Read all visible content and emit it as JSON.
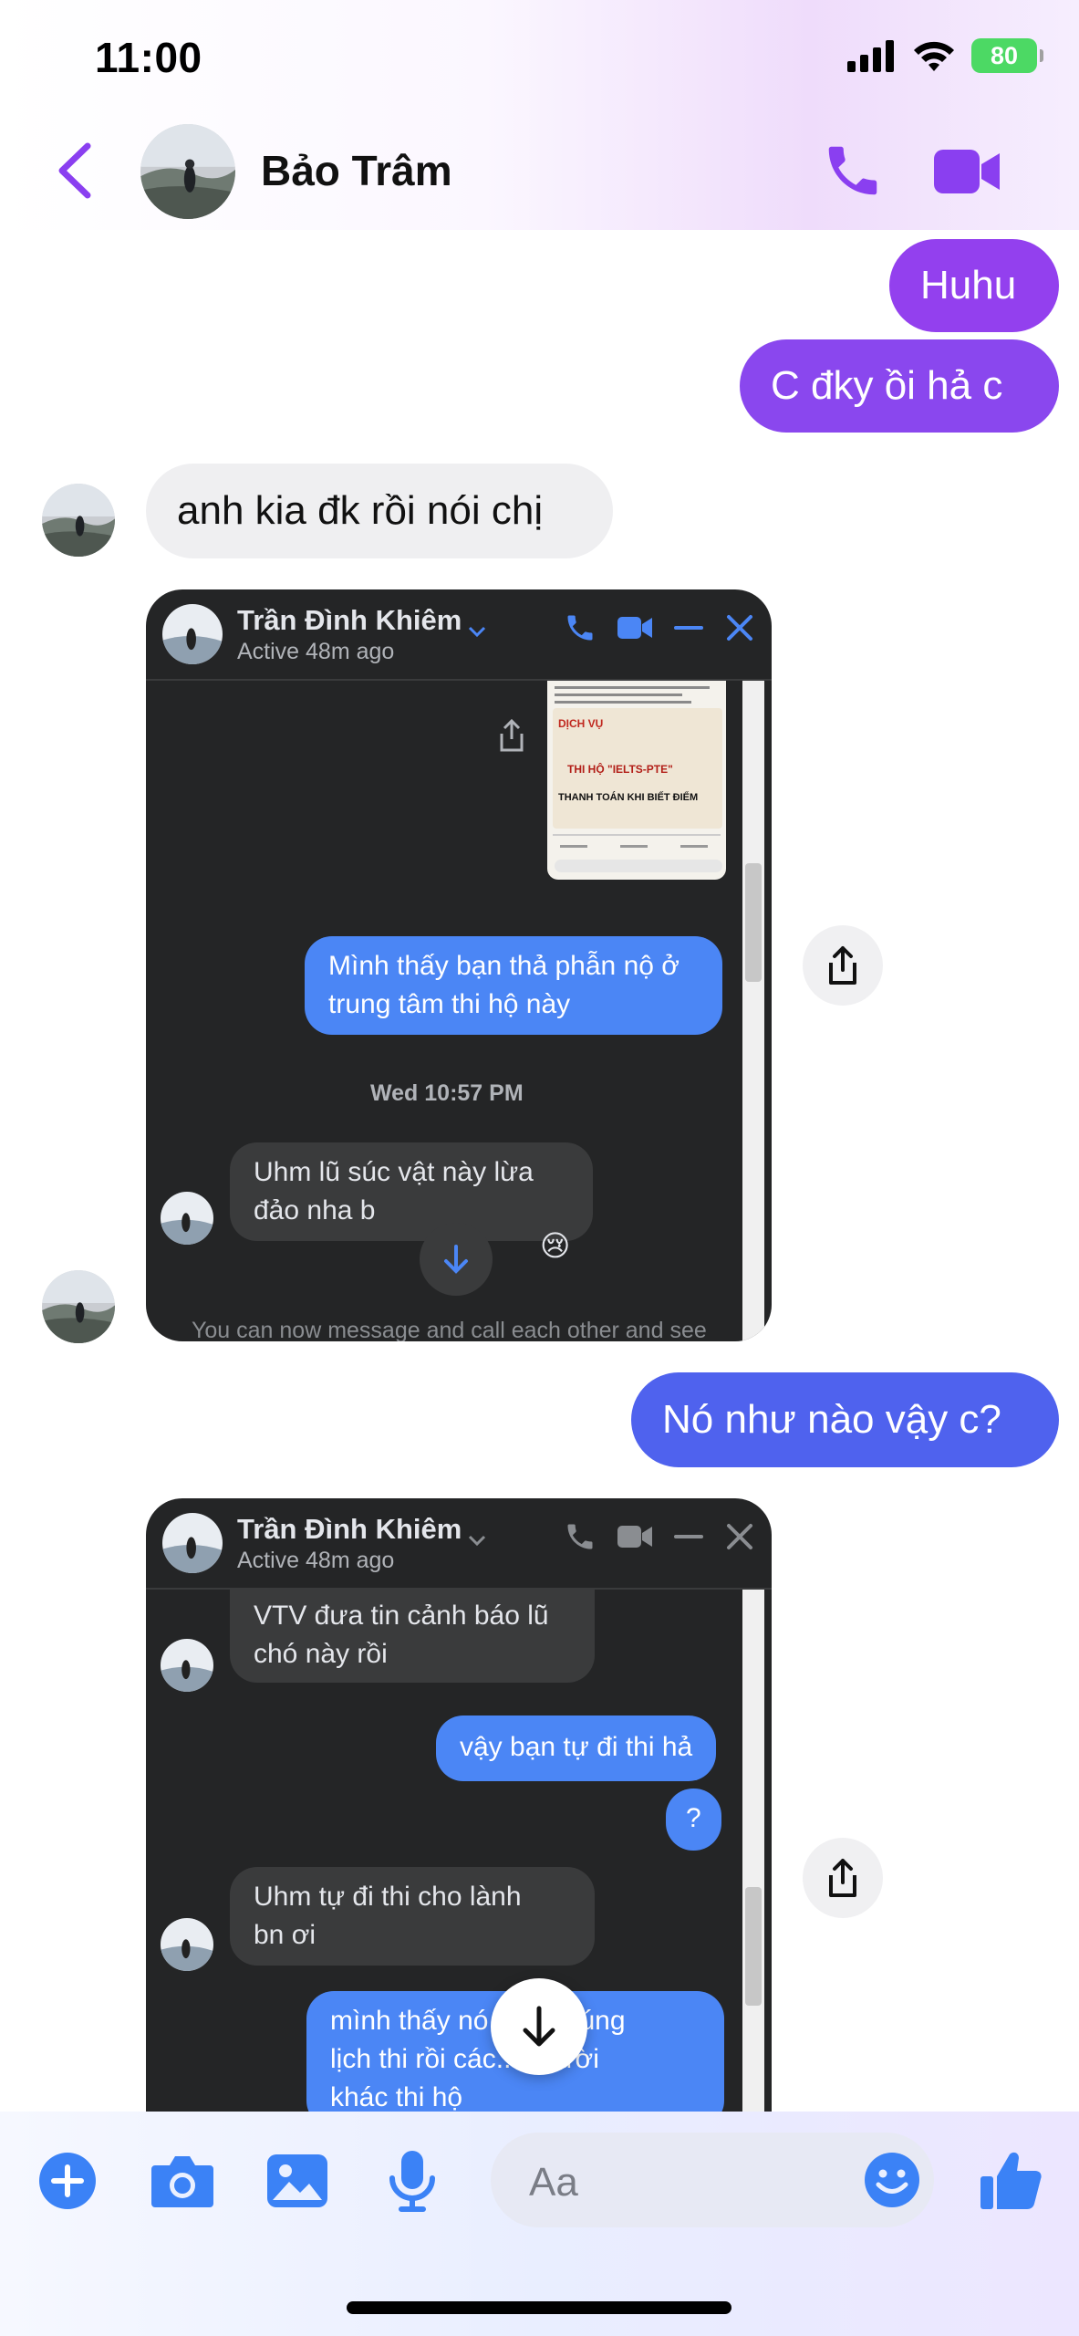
{
  "status_bar": {
    "time": "11:00",
    "battery": "80"
  },
  "header": {
    "contact_name": "Bảo Trâm"
  },
  "messages": [
    {
      "id": "m1",
      "text": "Huhu"
    },
    {
      "id": "m2",
      "text": "C đky ồi hả c"
    },
    {
      "id": "m3",
      "text": "anh kia đk rồi nói chị"
    },
    {
      "id": "m4",
      "text": "Nó như nào vậy c?"
    }
  ],
  "shared_screenshot_1": {
    "name": "Trần Đình Khiêm",
    "active": "Active 48m ago",
    "ad_lines": [
      "DỊCH VỤ",
      "THI HỘ \"IELTS-PTE\"",
      "THANH TOÁN KHI BIẾT ĐIỂM"
    ],
    "mine_text": [
      "Mình thấy bạn thả phẫn nộ ở",
      "trung tâm thi hộ này"
    ],
    "timestamp": "Wed 10:57 PM",
    "theirs_text": [
      "Uhm lũ súc vật này lừa",
      "đảo nha b"
    ],
    "reaction": "😢",
    "footer_text": "You can now message and call each other and see"
  },
  "shared_screenshot_2": {
    "name": "Trần Đình Khiêm",
    "active": "Active 48m ago",
    "b1": [
      "VTV đưa tin cảnh báo lũ",
      "chó này rồi"
    ],
    "b2": "vậy bạn tự đi thi hả",
    "b3": "?",
    "b4": [
      "Uhm tự đi thi cho lành",
      "bn ơi"
    ],
    "b5": [
      "mình thấy nó ... ập đúng",
      "lịch thi rồi các... người",
      "khác thi hộ"
    ]
  },
  "composer": {
    "placeholder": "Aa"
  },
  "colors": {
    "accent": "#7a3cf5",
    "outgoing_top": "#9b3ff0",
    "outgoing_bottom": "#5a5ff0",
    "icon_blue": "#3b82f6"
  }
}
